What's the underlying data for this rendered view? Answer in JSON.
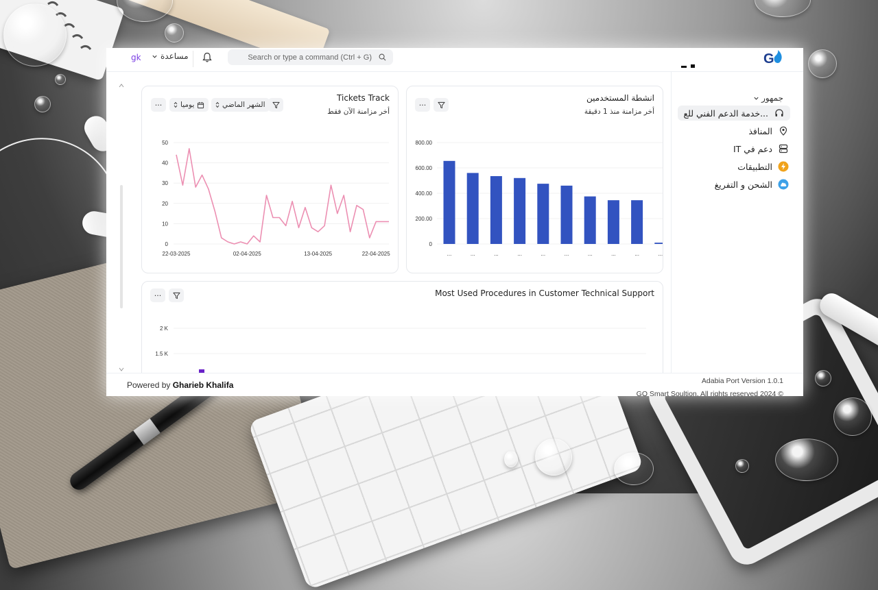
{
  "header": {
    "user_initials": "gk",
    "help_label": "مساعدة",
    "search_placeholder": "Search or type a command (Ctrl + G)",
    "logo_text": "GO"
  },
  "sidebar": {
    "group_label": "جمهور",
    "items": [
      {
        "label": "خدمة الدعم الفني للع...",
        "icon": "headset-icon",
        "active": true
      },
      {
        "label": "المنافذ",
        "icon": "location-pin-icon"
      },
      {
        "label": "IT دعم في",
        "icon": "server-icon"
      },
      {
        "label": "التطبيقات",
        "icon": "lightning-icon",
        "icon_color": "#f0a31c"
      },
      {
        "label": "الشحن و التفريغ",
        "icon": "cloud-upload-icon",
        "icon_color": "#3da1e8"
      }
    ]
  },
  "cards": {
    "tickets": {
      "title": "Tickets Track",
      "subtitle": "أخر مزامنة الآن فقط",
      "period_select": "الشهر الماضي",
      "interval_select": "يوميا",
      "more_label": "···"
    },
    "activity": {
      "title": "انشطة المستخدمين",
      "subtitle": "أخر مزامنة منذ 1 دقيقة",
      "more_label": "···"
    },
    "procedures": {
      "title": "Most Used Procedures in Customer Technical Support",
      "more_label": "···"
    }
  },
  "footer": {
    "powered_prefix": "Powered by ",
    "powered_name": "Gharieb Khalifa",
    "version": "Adabia Port Version 1.0.1",
    "copyright": "GO Smart Soultion. All rights reserved 2024 ©"
  },
  "colors": {
    "line": "#ec8fb2",
    "bar": "#3253c0",
    "accent": "#7b3fe4",
    "procedure_bar": "#6a22c8"
  },
  "chart_data": [
    {
      "type": "line",
      "title": "Tickets Track",
      "x_tick_labels": [
        "22-03-2025",
        "02-04-2025",
        "13-04-2025",
        "22-04-2025"
      ],
      "x_range": [
        "2025-03-22",
        "2025-04-24"
      ],
      "ylim": [
        0,
        50
      ],
      "y_ticks": [
        "50",
        "40",
        "30",
        "20",
        "10",
        "0"
      ],
      "grid": true,
      "series": [
        {
          "x": [
            "2025-03-22",
            "2025-03-23",
            "2025-03-24",
            "2025-03-25",
            "2025-03-26",
            "2025-03-27",
            "2025-03-28",
            "2025-03-29",
            "2025-03-30",
            "2025-03-31",
            "2025-04-01",
            "2025-04-02",
            "2025-04-03",
            "2025-04-04",
            "2025-04-05",
            "2025-04-06",
            "2025-04-07",
            "2025-04-08",
            "2025-04-09",
            "2025-04-10",
            "2025-04-11",
            "2025-04-12",
            "2025-04-13",
            "2025-04-14",
            "2025-04-15",
            "2025-04-16",
            "2025-04-17",
            "2025-04-18",
            "2025-04-19",
            "2025-04-20",
            "2025-04-21",
            "2025-04-22",
            "2025-04-23",
            "2025-04-24"
          ],
          "values": [
            44,
            29,
            47,
            28,
            34,
            27,
            16,
            3,
            1,
            0,
            1,
            0,
            4,
            1,
            24,
            13,
            13,
            9,
            21,
            8,
            18,
            8,
            6,
            9,
            29,
            15,
            24,
            6,
            19,
            17,
            3,
            11,
            11,
            11
          ]
        }
      ]
    },
    {
      "type": "bar",
      "title": "انشطة المستخدمين",
      "categories": [
        "...",
        "...",
        "...",
        "...",
        "...",
        "...",
        "...",
        "...",
        "...",
        "..."
      ],
      "values": [
        655,
        560,
        535,
        520,
        475,
        460,
        375,
        345,
        345,
        10
      ],
      "ylim": [
        0,
        800
      ],
      "y_ticks": [
        "800.00",
        "600.00",
        "400.00",
        "200.00",
        "0"
      ],
      "grid": true
    },
    {
      "type": "bar",
      "title": "Most Used Procedures in Customer Technical Support",
      "y_ticks": [
        "2 K",
        "1.5 K"
      ],
      "grid": true
    }
  ]
}
